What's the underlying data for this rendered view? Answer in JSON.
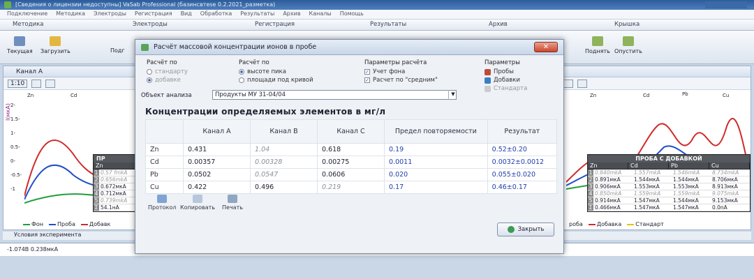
{
  "window": {
    "title": "[Сведения о лицензии недоступны] VaSab Professional (базинсвтеsе 0.2.2021_разметка)"
  },
  "menu": [
    "Подключение",
    "Методика",
    "Электроды",
    "Регистрация",
    "Вид",
    "Обработка",
    "Результаты",
    "Архив",
    "Каналы",
    "Помощь"
  ],
  "ribbon_tabs": [
    "Методика",
    "Электроды",
    "Регистрация",
    "Результаты",
    "Архив",
    "Крышка"
  ],
  "ribbon_left": {
    "current_label": "Текущая",
    "load_label": "Загрузить",
    "partial_label": "Подг"
  },
  "ribbon_right": {
    "connect_label": "Поднять",
    "lower_label": "Опустить"
  },
  "left_panel": {
    "title": "Канал А",
    "zoom": "1:10",
    "y_axis_label": "I(мкА)",
    "y_ticks": [
      "2-",
      "1.5-",
      "1-",
      "0.5-",
      "0-",
      "-0.5-",
      "-1"
    ],
    "elements": [
      "Zn",
      "Cd"
    ],
    "overlay": {
      "header": "ПР",
      "col": "Zn",
      "rows": [
        {
          "n": "1",
          "v": "0.57 fmkA",
          "dim": true
        },
        {
          "n": "2",
          "v": "0.656mkA",
          "dim": true
        },
        {
          "n": "3",
          "v": "0.672мкА",
          "dim": false
        },
        {
          "n": "4",
          "v": "0.712мкА",
          "dim": false
        },
        {
          "n": "5",
          "v": "0.739mkA",
          "dim": true
        },
        {
          "n": "Σ",
          "v": "54.1нА",
          "dim": false
        }
      ]
    },
    "legend": [
      {
        "label": "Фон",
        "color": "#1f9e3a"
      },
      {
        "label": "Проба",
        "color": "#1f4fc8"
      },
      {
        "label": "Добавк",
        "color": "#d02a2a"
      }
    ]
  },
  "right_panel": {
    "elements": [
      "Zn",
      "Cd",
      "Pb",
      "Cu"
    ],
    "overlay": {
      "header": "ПРОБА С ДОБАВКОЙ",
      "cols": [
        "Zn",
        "Cd",
        "Pb",
        "Cu"
      ],
      "rows": [
        {
          "n": "1",
          "v": [
            "0.840mkA",
            "1.557mkA",
            "1.546mkA",
            "8.734mkA"
          ],
          "dim": true
        },
        {
          "n": "2",
          "v": [
            "0.891мкА",
            "1.544мкА",
            "1.544мкА",
            "8.706мкА"
          ],
          "dim": false
        },
        {
          "n": "3",
          "v": [
            "0.906мкА",
            "1.553мкА",
            "1.553мкА",
            "8.913мкА"
          ],
          "dim": false
        },
        {
          "n": "4",
          "v": [
            "0.850mkA",
            "1.559mkA",
            "1.559mkA",
            "9.075mkA"
          ],
          "dim": true
        },
        {
          "n": "5",
          "v": [
            "0.914мкА",
            "1.547мкА",
            "1.544мкА",
            "9.153мкА"
          ],
          "dim": false
        },
        {
          "n": "Σ",
          "v": [
            "0.466мкА",
            "1.547мкА",
            "1.547мкА",
            "0.0nA"
          ],
          "dim": false
        }
      ]
    },
    "legend": [
      {
        "label": "роба",
        "color": "#1f4fc8"
      },
      {
        "label": "Добавка",
        "color": "#d02a2a"
      },
      {
        "label": "Стандарт",
        "color": "#e2c21b"
      }
    ]
  },
  "conditions_label": "Условия эксперимента",
  "status": {
    "coords": "-1.074В  0.238мкА"
  },
  "dialog": {
    "title": "Расчёт массовой концентрации ионов в пробе",
    "close_x": "✕",
    "calc_group": {
      "title": "Расчёт по",
      "options": [
        {
          "label": "стандарту",
          "state": "off",
          "disabled": true
        },
        {
          "label": "добавке",
          "state": "on",
          "disabled": true
        }
      ]
    },
    "peak_group": {
      "title": "Расчёт по",
      "options": [
        {
          "label": "высоте пика",
          "state": "on"
        },
        {
          "label": "площади под кривой",
          "state": "off"
        }
      ]
    },
    "params_group": {
      "title": "Параметры расчёта",
      "options": [
        {
          "label": "Учет фона",
          "checked": true
        },
        {
          "label": "Расчет по \"средним\"",
          "checked": true
        }
      ]
    },
    "params2_group": {
      "title": "Параметры",
      "items": [
        {
          "label": "Пробы"
        },
        {
          "label": "Добавки"
        },
        {
          "label": "Стандарта",
          "disabled": true
        }
      ]
    },
    "object_label": "Объект анализа",
    "object_value": "Продукты МУ 31-04/04",
    "conc_title": "Концентрации определяемых элементов в  мг/л",
    "table": {
      "headers": [
        "",
        "Канал А",
        "Канал В",
        "Канал С",
        "Предел повторяемости",
        "Результат"
      ],
      "rows": [
        {
          "el": "Zn",
          "a": "0.431",
          "b": "1.04",
          "c": "0.618",
          "limit": "0.19",
          "result": "0.52±0.20",
          "dim": [
            "b"
          ]
        },
        {
          "el": "Cd",
          "a": "0.00357",
          "b": "0.00328",
          "c": "0.00275",
          "limit": "0.0011",
          "result": "0.0032±0.0012",
          "dim": [
            "b"
          ]
        },
        {
          "el": "Pb",
          "a": "0.0502",
          "b": "0.0547",
          "c": "0.0606",
          "limit": "0.020",
          "result": "0.055±0.020",
          "dim": [
            "b"
          ]
        },
        {
          "el": "Cu",
          "a": "0.422",
          "b": "0.496",
          "c": "0.219",
          "limit": "0.17",
          "result": "0.46±0.17",
          "dim": [
            "c"
          ]
        }
      ]
    },
    "buttons": {
      "protocol": "Протокол",
      "copy": "Копировать",
      "print": "Печать",
      "close": "Закрыть"
    }
  }
}
